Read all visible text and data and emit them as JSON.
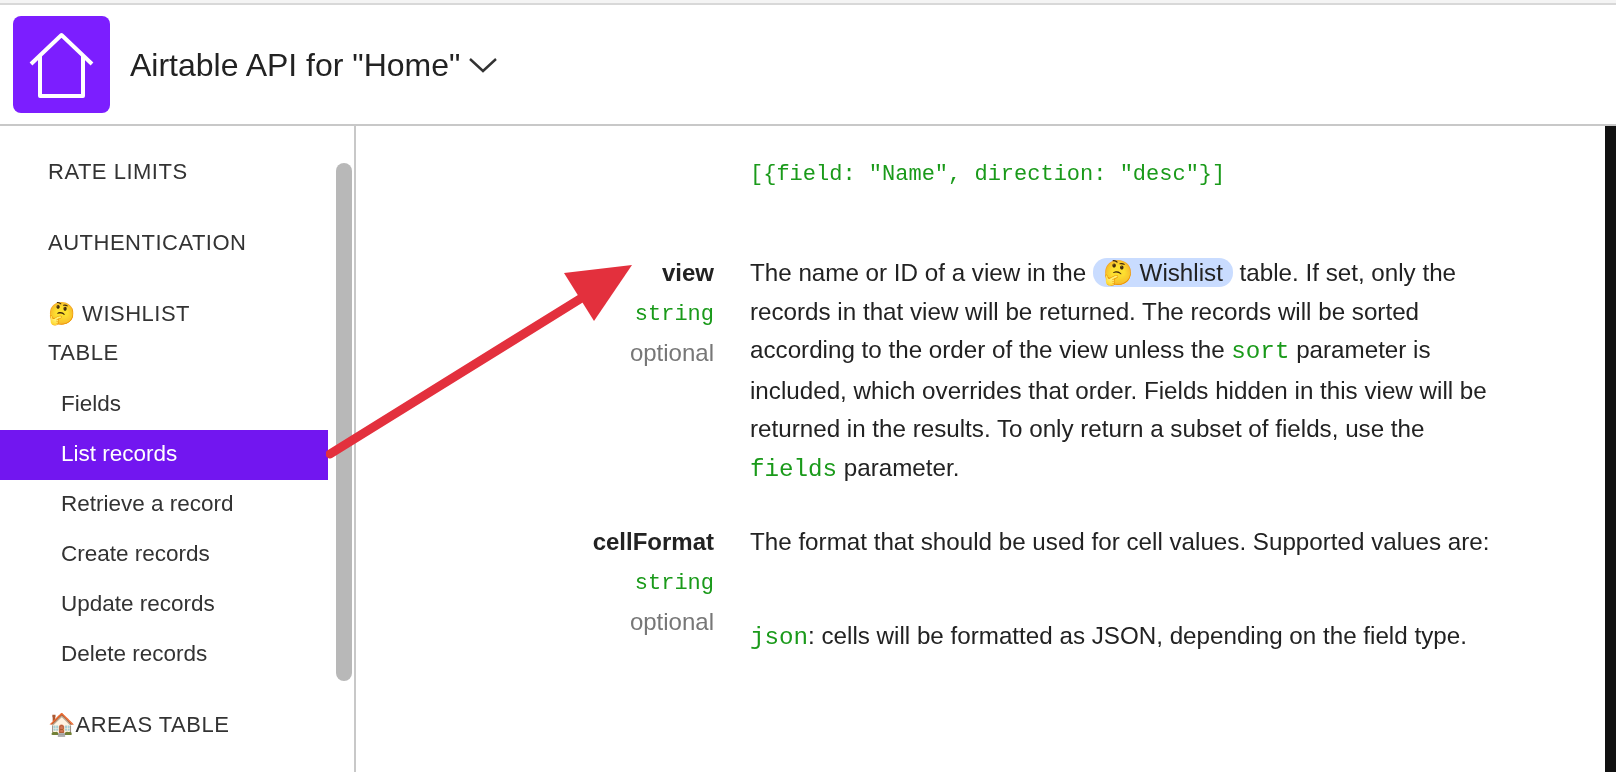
{
  "header": {
    "title": "Airtable API for \"Home\""
  },
  "sidebar": {
    "items": [
      {
        "kind": "section",
        "label": "RATE LIMITS"
      },
      {
        "kind": "section",
        "label": "AUTHENTICATION"
      },
      {
        "kind": "section",
        "label": "🤔 WISHLIST TABLE"
      },
      {
        "kind": "link",
        "label": "Fields",
        "selected": false
      },
      {
        "kind": "link",
        "label": "List records",
        "selected": true
      },
      {
        "kind": "link",
        "label": "Retrieve a record",
        "selected": false
      },
      {
        "kind": "link",
        "label": "Create records",
        "selected": false
      },
      {
        "kind": "link",
        "label": "Update records",
        "selected": false
      },
      {
        "kind": "link",
        "label": "Delete records",
        "selected": false
      },
      {
        "kind": "section",
        "label": "🏠AREAS TABLE"
      }
    ]
  },
  "content": {
    "code_example": "[{field: \"Name\", direction: \"desc\"}]",
    "params": [
      {
        "name": "view",
        "type": "string",
        "requirement": "optional",
        "paragraphs": [
          [
            {
              "kind": "text",
              "text": "The name or ID of a view in the "
            },
            {
              "kind": "pill",
              "text": "🤔 Wishlist"
            },
            {
              "kind": "text",
              "text": " table. If set, only the records in that view will be returned. The records will be sorted according to the order of the view unless the "
            },
            {
              "kind": "code",
              "text": "sort"
            },
            {
              "kind": "text",
              "text": " parameter is included, which overrides that order. Fields hidden in this view will be returned in the results. To only return a subset of fields, use the "
            },
            {
              "kind": "code",
              "text": "fields"
            },
            {
              "kind": "text",
              "text": " parameter."
            }
          ]
        ]
      },
      {
        "name": "cellFormat",
        "type": "string",
        "requirement": "optional",
        "paragraphs": [
          [
            {
              "kind": "text",
              "text": "The format that should be used for cell values. Supported values are:"
            }
          ],
          [
            {
              "kind": "code",
              "text": "json"
            },
            {
              "kind": "text",
              "text": ": cells will be formatted as JSON, depending on the field type."
            }
          ]
        ]
      }
    ]
  }
}
